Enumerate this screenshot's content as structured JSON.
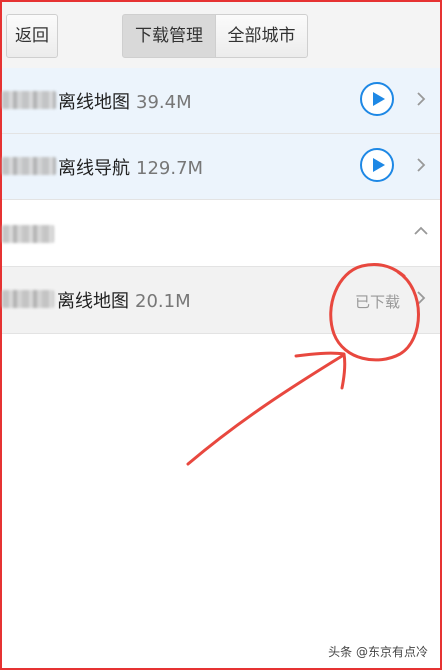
{
  "header": {
    "back_label": "返回",
    "tabs": [
      "下载管理",
      "全部城市"
    ]
  },
  "rows": [
    {
      "title": "离线地图",
      "size": "39.4M"
    },
    {
      "title": "离线导航",
      "size": "129.7M"
    },
    {
      "title": "离线地图",
      "size": "20.1M",
      "status": "已下载"
    }
  ],
  "watermark": "头条 @东京有点冷",
  "colors": {
    "accent": "#1e88e5",
    "annotation": "#e63232"
  }
}
